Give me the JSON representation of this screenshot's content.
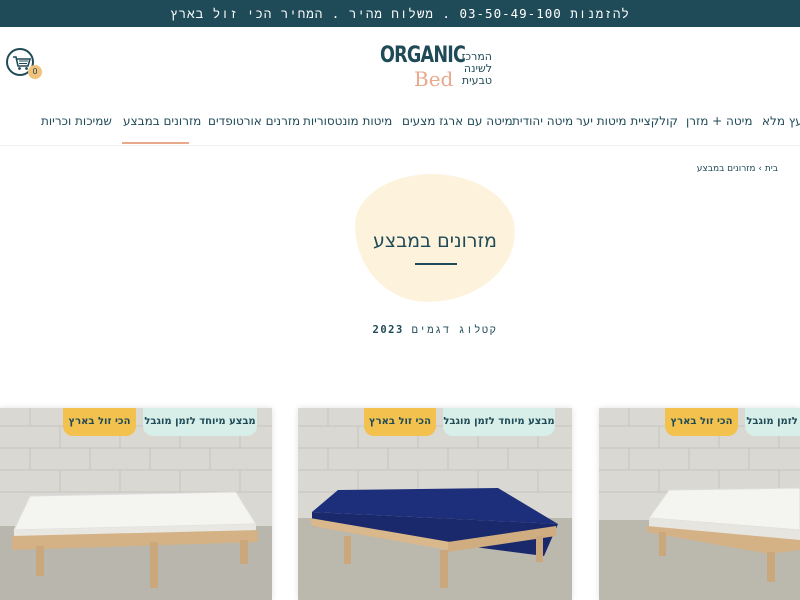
{
  "topbar": {
    "text": "להזמנות 03-50-49-100 . משלוח מהיר . המחיר הכי זול בארץ"
  },
  "cart": {
    "count": "0"
  },
  "logo": {
    "word1": "ORGANIC",
    "word2": "Bed",
    "tagline": "המרכז לשינה טבעית"
  },
  "nav": {
    "items": [
      "מעץ מלא",
      "מיטה + מזרן",
      "קולקציית מיטות יער",
      "מיטה יהודית",
      "מיטה עם ארגז מצעים",
      "מיטות מונטסוריות",
      "מזרנים אורטופדים",
      "מזרונים במבצע",
      "שמיכות וכריות"
    ],
    "active": "מזרונים במבצע"
  },
  "breadcrumb": {
    "home": "בית",
    "sep": "›",
    "current": "מזרונים במבצע"
  },
  "hero": {
    "title": "מזרונים במבצע",
    "catalog_text": "קטלוג דגמים",
    "catalog_year": "2023"
  },
  "products": [
    {
      "badge_sale": "מבצע מיוחד לזמן מוגבל",
      "badge_cheap": "הכי זול בארץ",
      "mattress_color": "#f4f4f0"
    },
    {
      "badge_sale": "מבצע מיוחד לזמן מוגבל",
      "badge_cheap": "הכי זול בארץ",
      "mattress_color": "#1d2e7a"
    },
    {
      "badge_sale": "מבצע מיוחד לזמן מוגבל",
      "badge_cheap": "הכי זול בארץ",
      "mattress_color": "#f4f4f0"
    }
  ],
  "colors": {
    "primary": "#1f4a57",
    "accent": "#e9a98c",
    "badge_yellow": "#f2c14e",
    "badge_mint": "#d8eee8"
  }
}
